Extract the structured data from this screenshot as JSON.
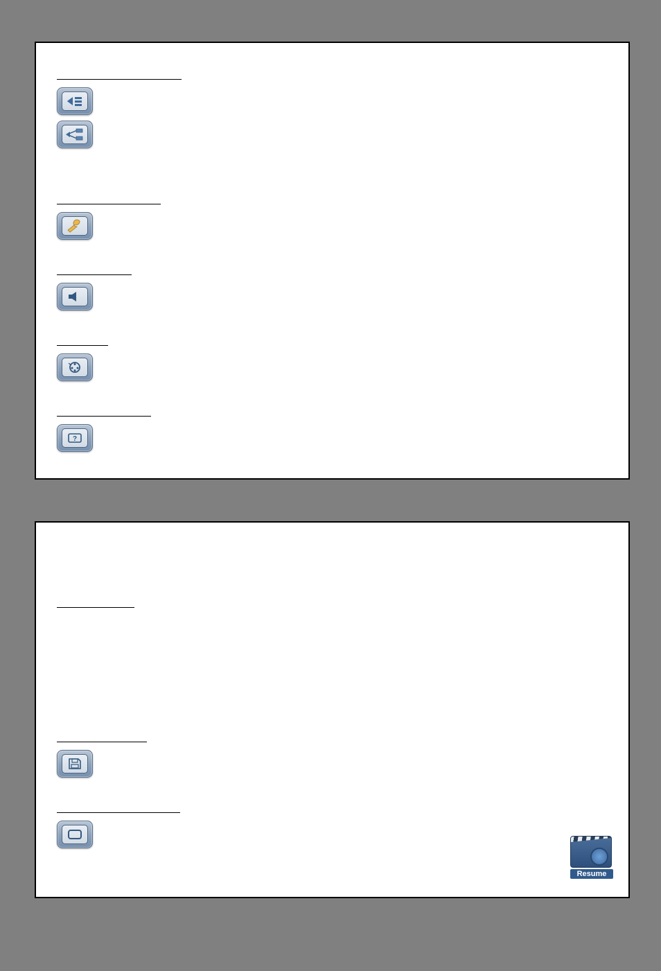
{
  "panel1": {
    "sections": [
      {
        "heading_key": "view_output_objects",
        "icons": [
          "arrow-list-icon",
          "tree-icon"
        ]
      },
      {
        "heading_key": "configuration",
        "icons": [
          "wrench-icon"
        ]
      },
      {
        "heading_key": "audio",
        "icons": [
          "speaker-icon"
        ]
      },
      {
        "heading_key": "video",
        "icons": [
          "reel-icon"
        ]
      },
      {
        "heading_key": "help",
        "icons": [
          "help-icon"
        ]
      }
    ]
  },
  "panel2": {
    "sections": [
      {
        "heading_key": "file"
      },
      {
        "heading_key": "save",
        "icons": [
          "save-icon"
        ]
      },
      {
        "heading_key": "presentation",
        "icons": [
          "screen-icon"
        ]
      }
    ]
  },
  "resume_label": "Resume"
}
